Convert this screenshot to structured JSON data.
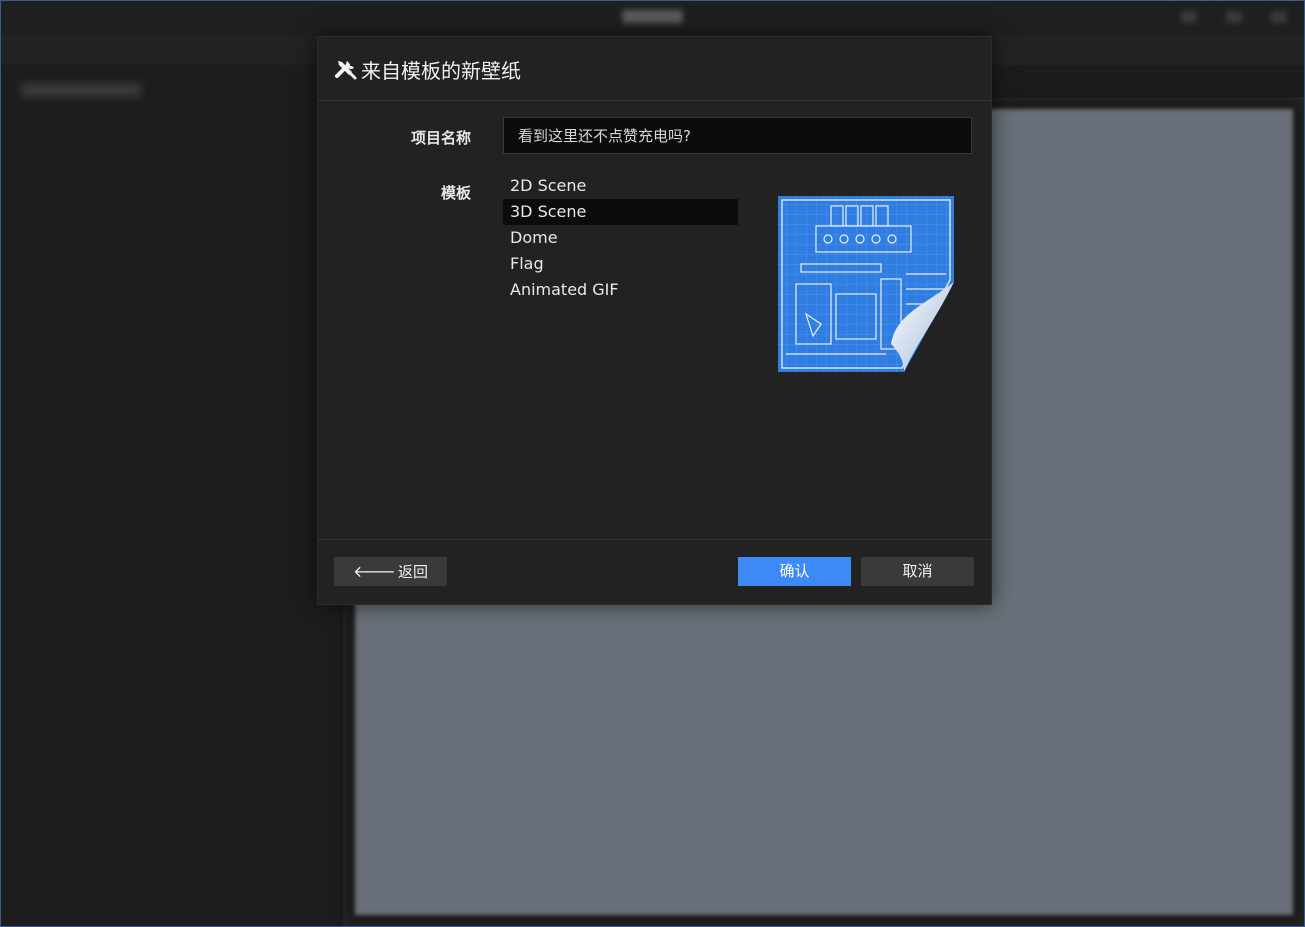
{
  "dialog": {
    "title": "来自模板的新壁纸",
    "title_icon": "tools-icon",
    "project_name_label": "项目名称",
    "project_name_value": "看到这里还不点赞充电吗?",
    "template_label": "模板",
    "templates": [
      {
        "label": "2D Scene",
        "selected": false
      },
      {
        "label": "3D Scene",
        "selected": true
      },
      {
        "label": "Dome",
        "selected": false
      },
      {
        "label": "Flag",
        "selected": false
      },
      {
        "label": "Animated GIF",
        "selected": false
      }
    ],
    "preview_icon": "blueprint-preview",
    "back_icon": "arrow-left-icon",
    "back_label": "返回",
    "confirm_label": "确认",
    "cancel_label": "取消"
  },
  "colors": {
    "accent": "#3d8af7",
    "dialog_bg": "#222222",
    "input_bg": "#0c0c0c",
    "blueprint": "#2f7de0"
  }
}
